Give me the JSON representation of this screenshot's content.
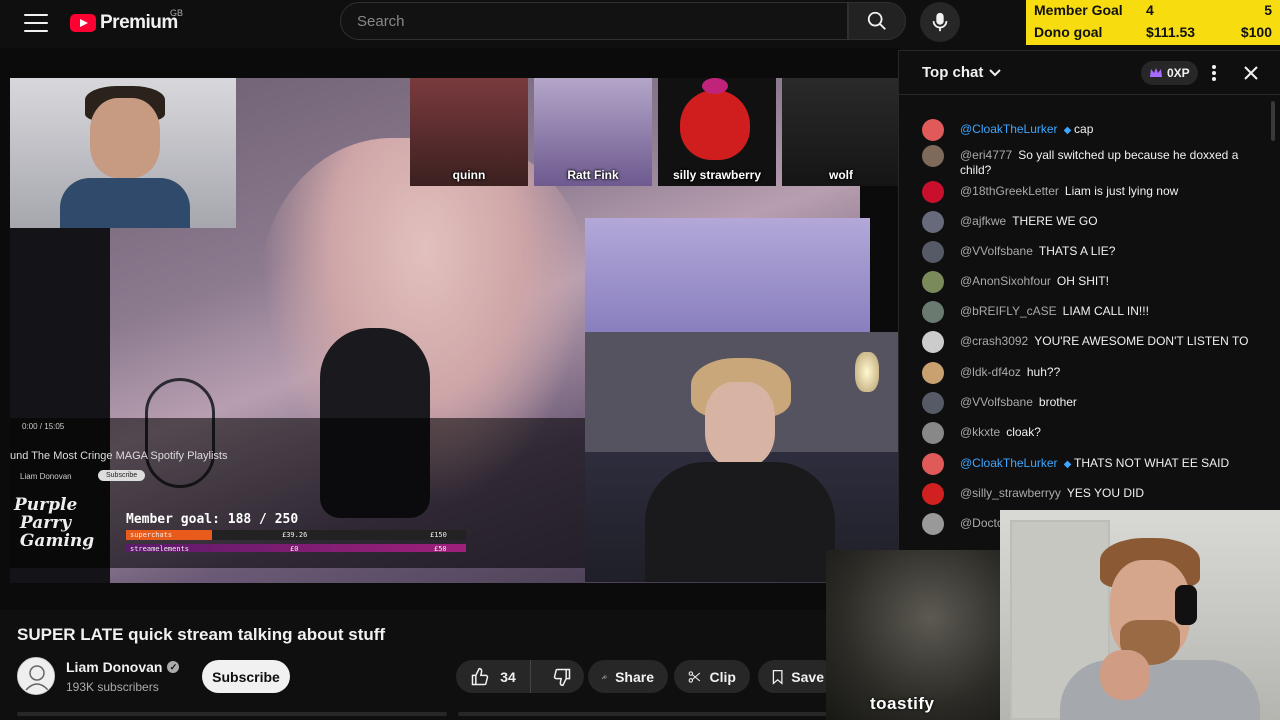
{
  "header": {
    "logo_text": "Premium",
    "region": "GB",
    "search_placeholder": "Search"
  },
  "goal_overlay": {
    "member_label": "Member Goal",
    "member_value": "4",
    "member_max": "5",
    "dono_label": "Dono goal",
    "dono_value": "$111.53",
    "dono_max": "$100",
    "bg_color": "#f7dd10"
  },
  "video": {
    "avatars": [
      {
        "label": "quinn"
      },
      {
        "label": "Ratt Fink"
      },
      {
        "label": "silly strawberry"
      },
      {
        "label": "wolf"
      }
    ],
    "inner_player": {
      "time": "0:00 / 15:05",
      "title": "und The Most Cringe MAGA Spotify Playlists",
      "channel": "Liam Donovan",
      "subscribe": "Subscribe",
      "logo_text": "Purple Parry Gaming",
      "member_goal": "Member goal: 188 / 250",
      "row1_label": "superchats",
      "row1_value": "£39.26",
      "row1_max": "£150",
      "row2_label": "streamelements",
      "row2_value": "£0",
      "row2_max": "£50"
    }
  },
  "details": {
    "title": "SUPER LATE quick stream talking about stuff",
    "channel_name": "Liam Donovan",
    "subscribers": "193K subscribers",
    "subscribe_label": "Subscribe",
    "like_count": "34",
    "share_label": "Share",
    "clip_label": "Clip",
    "save_label": "Save"
  },
  "chat": {
    "title": "Top chat",
    "xp_label": "0XP",
    "messages": [
      {
        "author": "@CloakTheLurker",
        "text": "cap",
        "member": true,
        "color": "#e05a5a"
      },
      {
        "author": "@eri4777",
        "text": "So yall switched up because he doxxed a child?",
        "member": false,
        "color": "#7d6a5a"
      },
      {
        "author": "@18thGreekLetter",
        "text": "Liam is just lying now",
        "member": false,
        "color": "#c8102e"
      },
      {
        "author": "@ajfkwe",
        "text": "THERE WE GO",
        "member": false,
        "color": "#666a7a"
      },
      {
        "author": "@VVolfsbane",
        "text": "THATS A LIE?",
        "member": false,
        "color": "#555a66"
      },
      {
        "author": "@AnonSixohfour",
        "text": "OH SHIT!",
        "member": false,
        "color": "#7a8a5a"
      },
      {
        "author": "@bREIFLY_cASE",
        "text": "LIAM CALL IN!!!",
        "member": false,
        "color": "#6a7a70"
      },
      {
        "author": "@crash3092",
        "text": "YOU'RE AWESOME DON'T LISTEN TO",
        "member": false,
        "color": "#ccc"
      },
      {
        "author": "@ldk-df4oz",
        "text": "huh??",
        "member": false,
        "color": "#c9a070"
      },
      {
        "author": "@VVolfsbane",
        "text": "brother",
        "member": false,
        "color": "#555a66"
      },
      {
        "author": "@kkxte",
        "text": "cloak?",
        "member": false,
        "color": "#888"
      },
      {
        "author": "@CloakTheLurker",
        "text": "THATS NOT WHAT EE SAID",
        "member": true,
        "color": "#e05a5a"
      },
      {
        "author": "@silly_strawberryy",
        "text": "YES YOU DID",
        "member": false,
        "color": "#d02020"
      },
      {
        "author": "@Docto",
        "text": "",
        "member": false,
        "color": "#999"
      }
    ]
  },
  "overlays": {
    "toastify_label": "toastify"
  }
}
